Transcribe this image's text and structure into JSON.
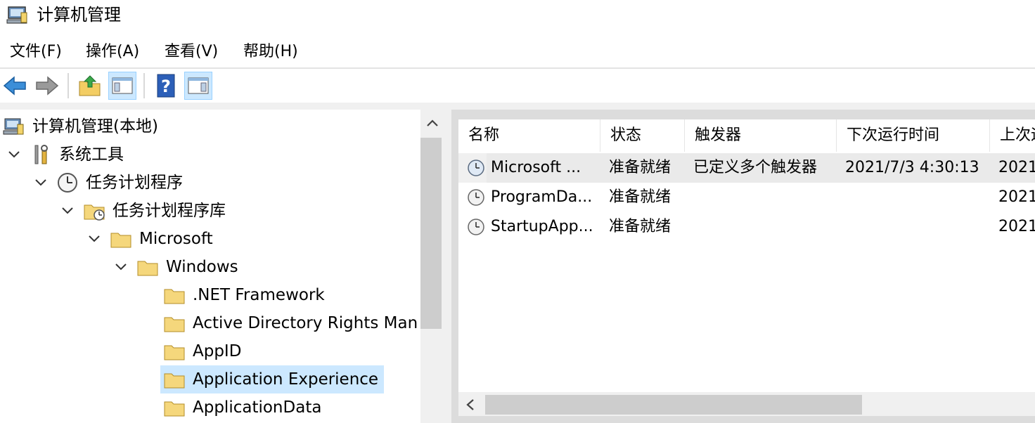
{
  "window": {
    "title": "计算机管理"
  },
  "menu": {
    "items": [
      "文件(F)",
      "操作(A)",
      "查看(V)",
      "帮助(H)"
    ]
  },
  "toolbar": {
    "buttons": [
      {
        "icon": "back-arrow-icon"
      },
      {
        "icon": "forward-arrow-icon"
      },
      {
        "icon": "up-folder-icon"
      },
      {
        "icon": "show-hide-console-tree-icon"
      },
      {
        "icon": "help-icon"
      },
      {
        "icon": "show-hide-action-pane-icon"
      }
    ]
  },
  "tree": {
    "items": [
      {
        "label": "计算机管理(本地)",
        "icon": "computer-management-icon",
        "expanded": null
      },
      {
        "label": "系统工具",
        "icon": "tools-icon",
        "expanded": true
      },
      {
        "label": "任务计划程序",
        "icon": "clock-icon",
        "expanded": true
      },
      {
        "label": "任务计划程序库",
        "icon": "task-library-folder-icon",
        "expanded": true
      },
      {
        "label": "Microsoft",
        "icon": "folder-icon",
        "expanded": true
      },
      {
        "label": "Windows",
        "icon": "folder-icon",
        "expanded": true
      },
      {
        "label": ".NET Framework",
        "icon": "folder-icon",
        "expanded": null
      },
      {
        "label": "Active Directory Rights Man",
        "icon": "folder-icon",
        "expanded": null
      },
      {
        "label": "AppID",
        "icon": "folder-icon",
        "expanded": null
      },
      {
        "label": "Application Experience",
        "icon": "folder-icon",
        "expanded": null,
        "selected": true
      },
      {
        "label": "ApplicationData",
        "icon": "folder-icon",
        "expanded": null
      }
    ]
  },
  "list": {
    "columns": [
      "名称",
      "状态",
      "触发器",
      "下次运行时间",
      "上次运"
    ],
    "rows": [
      {
        "name": "Microsoft ...",
        "status": "准备就绪",
        "trigger": "已定义多个触发器",
        "next": "2021/7/3 4:30:13",
        "last": "2021"
      },
      {
        "name": "ProgramDa...",
        "status": "准备就绪",
        "trigger": "",
        "next": "",
        "last": "2021"
      },
      {
        "name": "StartupApp...",
        "status": "准备就绪",
        "trigger": "",
        "next": "",
        "last": "2021"
      }
    ]
  },
  "colors": {
    "selection": "#cce8ff",
    "accent": "#1e73be"
  }
}
